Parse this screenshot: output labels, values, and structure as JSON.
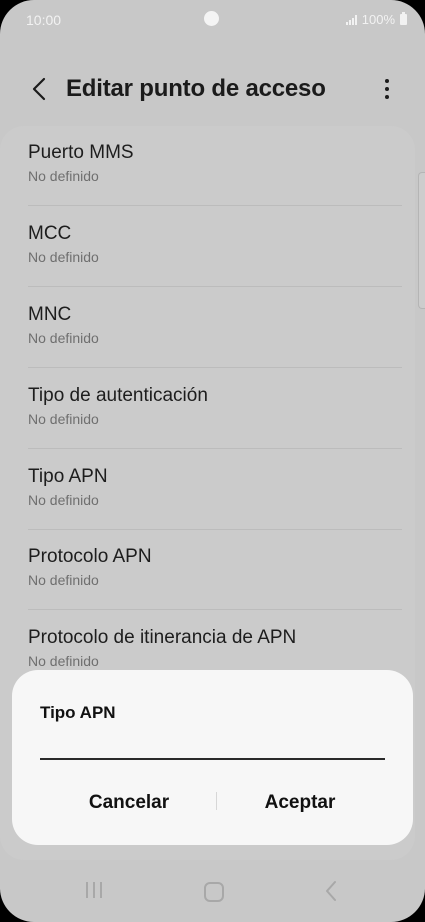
{
  "status_bar": {
    "time": "10:00",
    "battery": "100%"
  },
  "app_bar": {
    "title": "Editar punto de acceso",
    "back_icon": "back-arrow-icon",
    "more_icon": "more-vertical-icon"
  },
  "settings": [
    {
      "label": "Puerto MMS",
      "value": "No definido"
    },
    {
      "label": "MCC",
      "value": "No definido"
    },
    {
      "label": "MNC",
      "value": "No definido"
    },
    {
      "label": "Tipo de autenticación",
      "value": "No definido"
    },
    {
      "label": "Tipo APN",
      "value": "No definido"
    },
    {
      "label": "Protocolo APN",
      "value": "No definido"
    },
    {
      "label": "Protocolo de itinerancia de APN",
      "value": "No definido"
    }
  ],
  "dialog": {
    "title": "Tipo APN",
    "input_value": "",
    "cancel_label": "Cancelar",
    "ok_label": "Aceptar"
  },
  "nav_bar": {
    "icons": [
      "recent-apps-icon",
      "home-icon",
      "back-icon"
    ]
  }
}
